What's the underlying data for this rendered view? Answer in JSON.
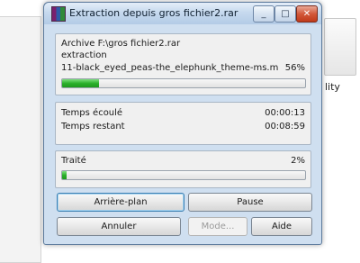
{
  "window": {
    "title": "Extraction depuis gros fichier2.rar",
    "controls": {
      "minimize": "_",
      "maximize": "□",
      "close": "✕"
    }
  },
  "background": {
    "partial_text": "lity"
  },
  "info": {
    "archive_line": "Archive F:\\gros fichier2.rar",
    "action_line": "extraction",
    "current_file": "11-black_eyed_peas-the_elephunk_theme-ms.m",
    "file_percent": "56%",
    "file_progress": 0.15
  },
  "time": {
    "elapsed_label": "Temps écoulé",
    "elapsed_value": "00:00:13",
    "remaining_label": "Temps restant",
    "remaining_value": "00:08:59"
  },
  "total": {
    "label": "Traité",
    "percent": "2%",
    "progress": 0.02
  },
  "buttons": {
    "background": "Arrière-plan",
    "pause": "Pause",
    "cancel": "Annuler",
    "mode": "Mode...",
    "help": "Aide"
  },
  "colors": {
    "progress_green": "#2bb02b",
    "close_red": "#c03a1a",
    "focus_blue": "#3c7fb1"
  },
  "icons": {
    "app": "winrar-icon"
  }
}
